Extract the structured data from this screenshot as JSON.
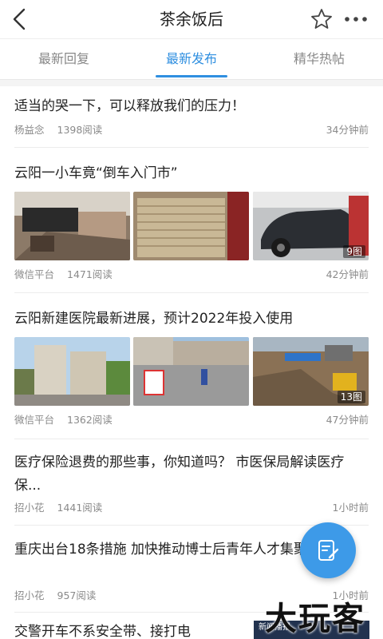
{
  "header": {
    "title": "茶余饭后",
    "back_icon": "chevron-left-icon",
    "favorite_icon": "star-icon",
    "more_icon": "more-dots-icon"
  },
  "tabs": [
    {
      "label": "最新回复",
      "active": false
    },
    {
      "label": "最新发布",
      "active": true
    },
    {
      "label": "精华热帖",
      "active": false
    }
  ],
  "accent_color": "#2f8fe0",
  "posts": [
    {
      "title": "适当的哭一下，可以释放我们的压力！",
      "author": "杨益念",
      "views": "1398阅读",
      "time": "34分钟前"
    },
    {
      "title": "云阳一小车竟“倒车入门市”",
      "author": "微信平台",
      "views": "1471阅读",
      "time": "42分钟前",
      "image_count": "9图"
    },
    {
      "title": "云阳新建医院最新进展，预计2022年投入使用",
      "author": "微信平台",
      "views": "1362阅读",
      "time": "47分钟前",
      "image_count": "13图"
    },
    {
      "title": "医疗保险退费的那些事，你知道吗？ 市医保局解读医疗保...",
      "author": "招小花",
      "views": "1441阅读",
      "time": "1小时前"
    },
    {
      "title": "重庆出台18条措施 加快推动博士后青年人才集聚",
      "author": "招小花",
      "views": "957阅读",
      "time": "1小时前"
    },
    {
      "title": "交警开车不系安全带、接打电"
    }
  ],
  "fab": {
    "icon": "compose-edit-icon"
  },
  "watermark": {
    "text": "大玩客",
    "snippet_title": "新闻播报"
  }
}
